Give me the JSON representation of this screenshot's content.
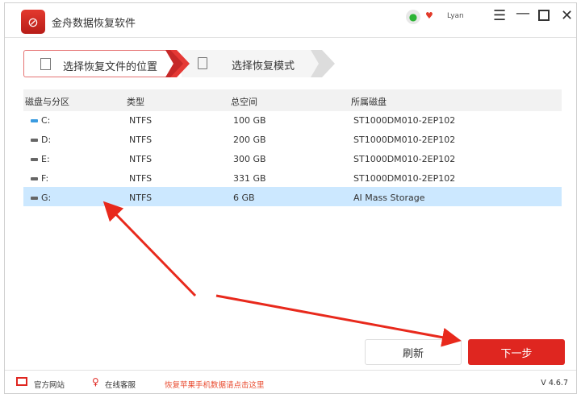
{
  "app": {
    "title": "金舟数据恢复软件",
    "user": "Lyan"
  },
  "steps": [
    {
      "label": "选择恢复文件的位置",
      "active": true
    },
    {
      "label": "选择恢复模式",
      "active": false
    }
  ],
  "table": {
    "headers": [
      "磁盘与分区",
      "类型",
      "总空间",
      "所属磁盘"
    ],
    "rows": [
      {
        "drive": "C:",
        "type": "NTFS",
        "size": "100 GB",
        "disk": "ST1000DM010-2EP102",
        "selected": false
      },
      {
        "drive": "D:",
        "type": "NTFS",
        "size": "200 GB",
        "disk": "ST1000DM010-2EP102",
        "selected": false
      },
      {
        "drive": "E:",
        "type": "NTFS",
        "size": "300 GB",
        "disk": "ST1000DM010-2EP102",
        "selected": false
      },
      {
        "drive": "F:",
        "type": "NTFS",
        "size": "331 GB",
        "disk": "ST1000DM010-2EP102",
        "selected": false
      },
      {
        "drive": "G:",
        "type": "NTFS",
        "size": "6 GB",
        "disk": "AI Mass Storage",
        "selected": true
      }
    ]
  },
  "buttons": {
    "refresh": "刷新",
    "next": "下一步"
  },
  "footer": {
    "website": "官方网站",
    "support": "在线客服",
    "iphone_link": "恢复苹果手机数据请点击这里",
    "version": "V 4.6.7"
  },
  "colors": {
    "accent": "#df2620",
    "selected_row": "#cce8ff"
  }
}
